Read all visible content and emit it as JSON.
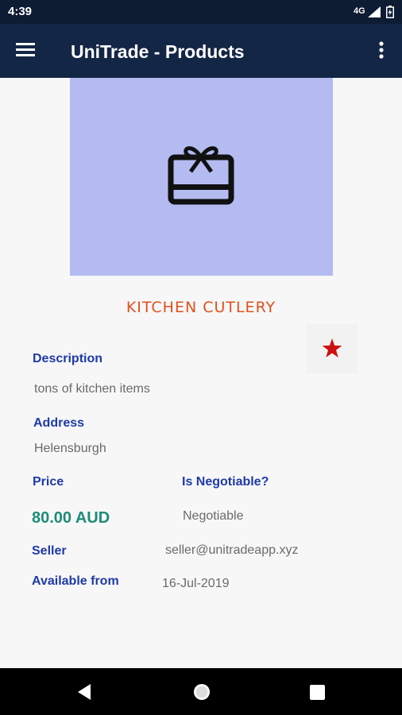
{
  "status_bar": {
    "time": "4:39",
    "network": "4G"
  },
  "app_bar": {
    "title": "UniTrade - Products"
  },
  "product": {
    "image_icon": "gift-card-icon",
    "title": "KITCHEN CUTLERY",
    "favorite_icon": "star-icon",
    "favorite_color": "#cc1111"
  },
  "details": {
    "description_label": "Description",
    "description_value": "tons of kitchen items",
    "address_label": "Address",
    "address_value": "Helensburgh",
    "price_label": "Price",
    "price_value": "80.00 AUD",
    "negotiable_label": "Is Negotiable?",
    "negotiable_value": "Negotiable",
    "seller_label": "Seller",
    "seller_value": "seller@unitradeapp.xyz",
    "available_label": "Available from",
    "available_value": "16-Jul-2019"
  },
  "colors": {
    "app_bar": "#142645",
    "status_bar": "#0d1b33",
    "image_bg": "#b3bbf1",
    "title": "#e2501d",
    "label": "#1f3aa8",
    "price": "#1e8c77"
  }
}
